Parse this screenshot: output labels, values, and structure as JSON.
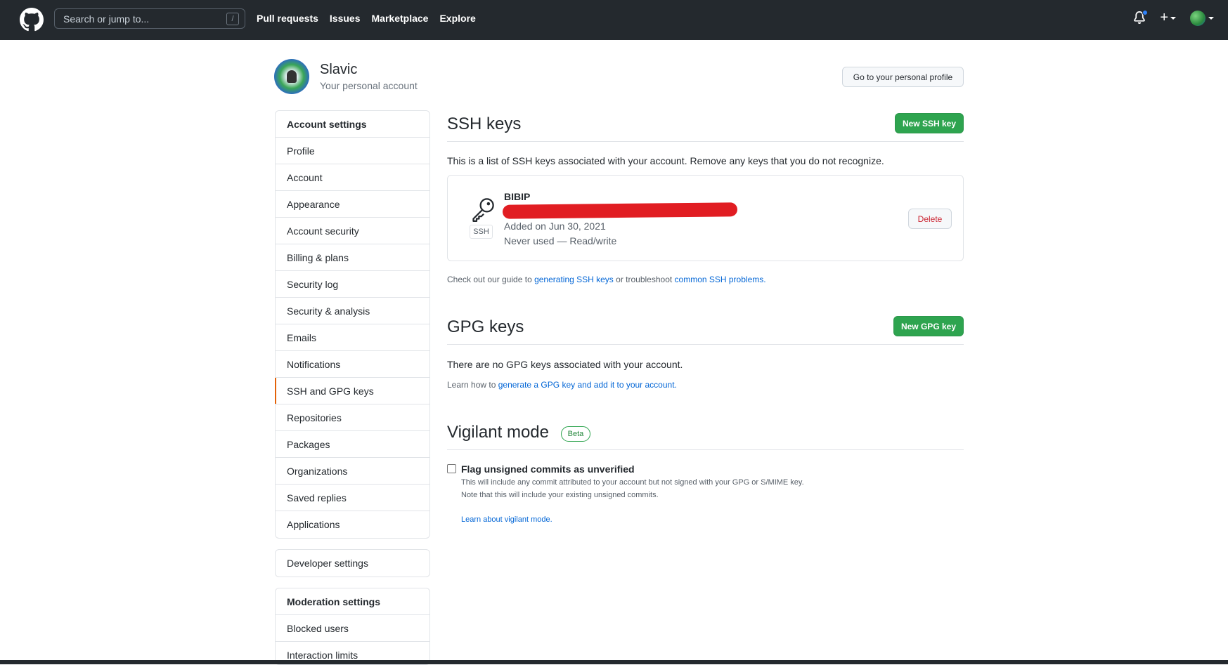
{
  "header": {
    "search_placeholder": "Search or jump to...",
    "search_shortcut": "/",
    "nav": [
      "Pull requests",
      "Issues",
      "Marketplace",
      "Explore"
    ],
    "plus": "+"
  },
  "user": {
    "name": "Slavic",
    "subtitle": "Your personal account",
    "profile_button": "Go to your personal profile"
  },
  "sidebar": {
    "account_settings": {
      "heading": "Account settings",
      "items": [
        "Profile",
        "Account",
        "Appearance",
        "Account security",
        "Billing & plans",
        "Security log",
        "Security & analysis",
        "Emails",
        "Notifications",
        "SSH and GPG keys",
        "Repositories",
        "Packages",
        "Organizations",
        "Saved replies",
        "Applications"
      ],
      "selected": "SSH and GPG keys"
    },
    "developer": "Developer settings",
    "moderation": {
      "heading": "Moderation settings",
      "items": [
        "Blocked users",
        "Interaction limits"
      ]
    }
  },
  "ssh": {
    "title": "SSH keys",
    "new_button": "New SSH key",
    "description": "This is a list of SSH keys associated with your account. Remove any keys that you do not recognize.",
    "key": {
      "name": "BIBIP",
      "badge": "SSH",
      "added": "Added on Jun 30, 2021",
      "usage": "Never used — Read/write",
      "delete": "Delete"
    },
    "guide_prefix": "Check out our guide to ",
    "guide_link1": "generating SSH keys",
    "guide_middle": " or troubleshoot ",
    "guide_link2": "common SSH problems."
  },
  "gpg": {
    "title": "GPG keys",
    "new_button": "New GPG key",
    "empty": "There are no GPG keys associated with your account.",
    "learn_prefix": "Learn how to ",
    "learn_link": "generate a GPG key and add it to your account."
  },
  "vigilant": {
    "title": "Vigilant mode",
    "badge": "Beta",
    "checkbox_label": "Flag unsigned commits as unverified",
    "line1": "This will include any commit attributed to your account but not signed with your GPG or S/MIME key.",
    "line2": "Note that this will include your existing unsigned commits.",
    "learn_link": "Learn about vigilant mode."
  },
  "colors": {
    "header_bg": "#24292e",
    "primary_green": "#2ea44f",
    "link": "#0366d6",
    "danger": "#cb2431",
    "selected_marker": "#e36209"
  }
}
